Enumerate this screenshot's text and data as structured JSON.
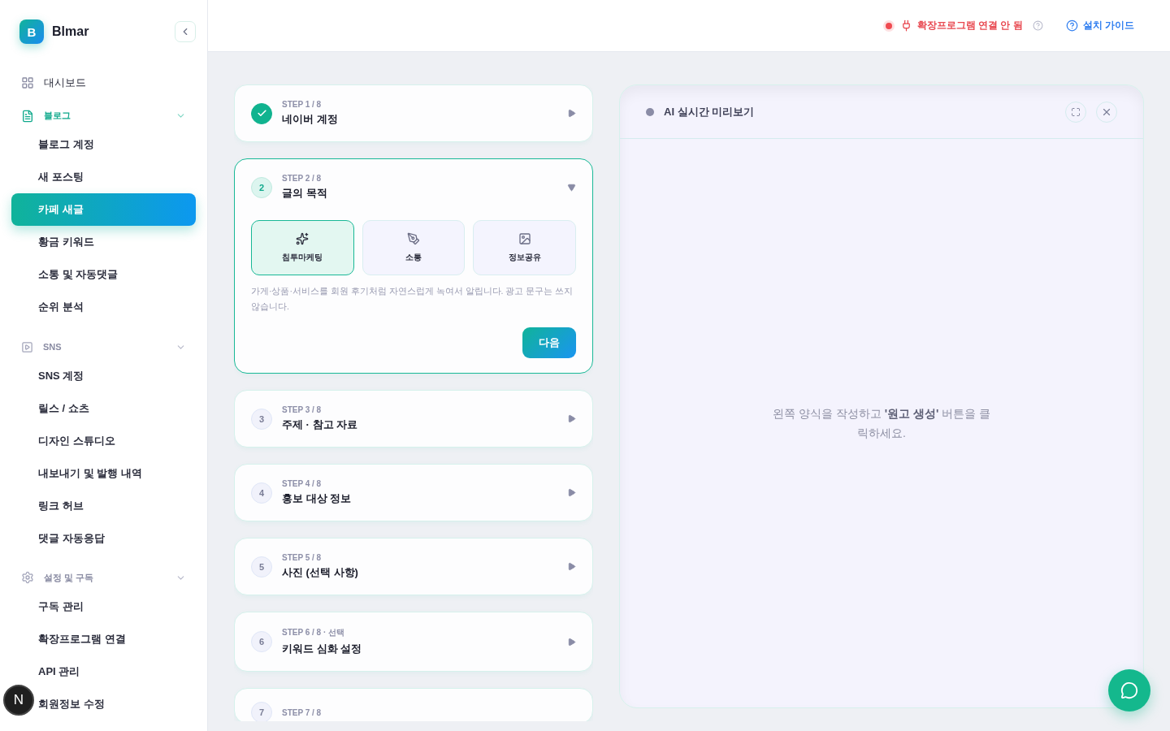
{
  "brand": {
    "logo_letter": "B",
    "name": "Blmar"
  },
  "sidebar": {
    "items": [
      {
        "kind": "link",
        "label": "대시보드",
        "selected": false
      },
      {
        "kind": "section",
        "label": "블로그",
        "expanded": true,
        "active": true,
        "children": [
          {
            "label": "블로그 계정",
            "selected": false
          },
          {
            "label": "새 포스팅",
            "selected": false
          },
          {
            "label": "카페 새글",
            "selected": true
          },
          {
            "label": "황금 키워드",
            "selected": false
          },
          {
            "label": "소통 및 자동댓글",
            "selected": false
          },
          {
            "label": "순위 분석",
            "selected": false
          }
        ]
      },
      {
        "kind": "section",
        "label": "SNS",
        "expanded": true,
        "active": false,
        "children": [
          {
            "label": "SNS 계정",
            "selected": false
          },
          {
            "label": "릴스 / 쇼츠",
            "selected": false
          },
          {
            "label": "디자인 스튜디오",
            "selected": false
          },
          {
            "label": "내보내기 및 발행 내역",
            "selected": false
          },
          {
            "label": "링크 허브",
            "selected": false
          },
          {
            "label": "댓글 자동응답",
            "selected": false
          }
        ]
      },
      {
        "kind": "section",
        "label": "설정 및 구독",
        "expanded": true,
        "active": false,
        "children": [
          {
            "label": "구독 관리",
            "selected": false
          },
          {
            "label": "확장프로그램 연결",
            "selected": false
          },
          {
            "label": "API 관리",
            "selected": false
          },
          {
            "label": "회원정보 수정",
            "selected": false
          }
        ]
      }
    ]
  },
  "topbar": {
    "extension_status": {
      "label": "확장프로그램 연결 안 됨",
      "connected": false
    },
    "guide_link": "설치 가이드"
  },
  "steps": [
    {
      "kind": "done",
      "step": "STEP 1 / 8",
      "title": "네이버 계정",
      "expanded": false
    },
    {
      "kind": "active",
      "number": "2",
      "step": "STEP 2 / 8",
      "title": "글의 목적",
      "expanded": true,
      "options": [
        {
          "label": "침투마케팅",
          "selected": true
        },
        {
          "label": "소통",
          "selected": false
        },
        {
          "label": "정보공유",
          "selected": false
        }
      ],
      "description": "가게·상품·서비스를 회원 후기처럼 자연스럽게 녹여서 알립니다. 광고 문구는 쓰지 않습니다.",
      "next_button": "다음"
    },
    {
      "kind": "pending",
      "number": "3",
      "step": "STEP 3 / 8",
      "title": "주제 · 참고 자료",
      "expanded": false
    },
    {
      "kind": "pending",
      "number": "4",
      "step": "STEP 4 / 8",
      "title": "홍보 대상 정보",
      "expanded": false
    },
    {
      "kind": "pending",
      "number": "5",
      "step": "STEP 5 / 8",
      "title": "사진 (선택 사항)",
      "expanded": false
    },
    {
      "kind": "pending",
      "number": "6",
      "step": "STEP 6 / 8 · 선택",
      "title": "키워드 심화 설정",
      "expanded": false
    },
    {
      "kind": "partial",
      "number": "7",
      "step": "STEP 7 / 8",
      "expanded": false
    }
  ],
  "preview": {
    "title": "AI 실시간 미리보기",
    "empty_text": "왼쪽 양식을 작성하고 **'원고 생성'** 버튼을 클릭하세요."
  },
  "dev_badge": "N"
}
